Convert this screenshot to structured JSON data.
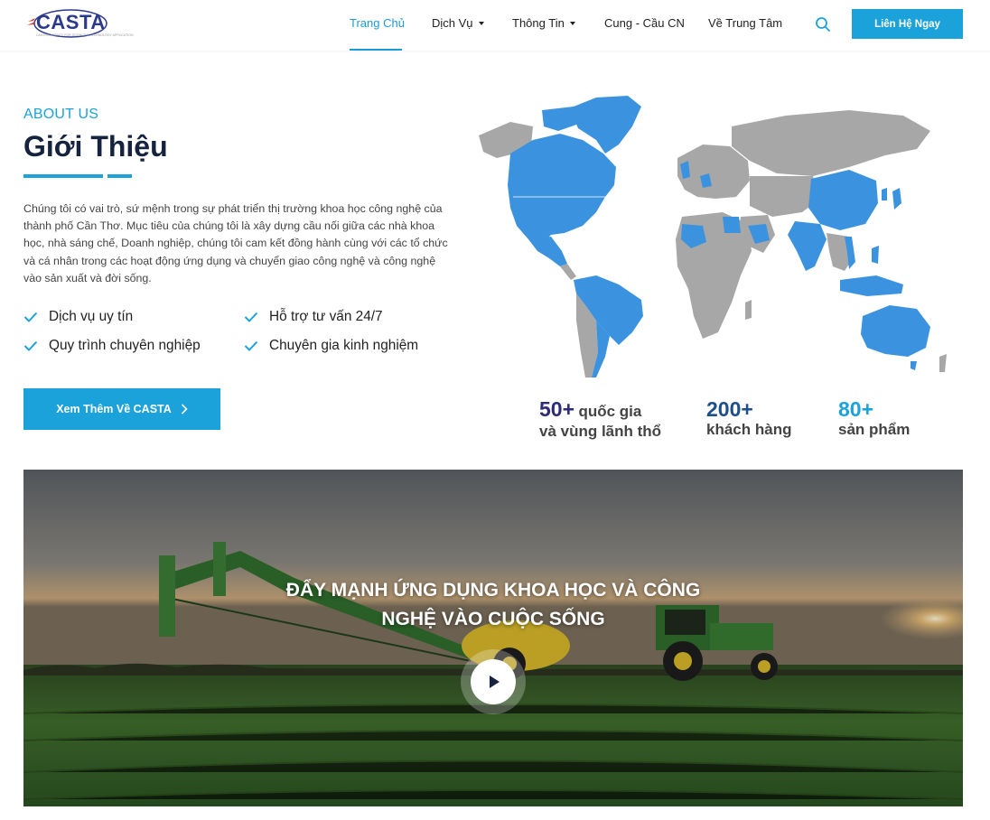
{
  "header": {
    "logo_text": "CASTA",
    "logo_tagline": "CANTHO AGENCY FOR SCIENCE & TECHNOLOGY APPLICATION",
    "nav": [
      {
        "label": "Trang Chủ",
        "active": true,
        "dropdown": false
      },
      {
        "label": "Dịch Vụ",
        "active": false,
        "dropdown": true
      },
      {
        "label": "Thông Tin",
        "active": false,
        "dropdown": true
      },
      {
        "label": "Cung - Cầu CN",
        "active": false,
        "dropdown": false
      },
      {
        "label": "Về Trung Tâm",
        "active": false,
        "dropdown": false
      }
    ],
    "search_icon": "search-icon",
    "contact_button": "Liên Hệ Ngay"
  },
  "about": {
    "eyebrow": "ABOUT US",
    "title": "Giới Thiệu",
    "description": "Chúng tôi có vai trò, sứ mệnh trong sự phát triển thị trường khoa học công nghệ của thành phố Cần Thơ. Mục tiêu của chúng tôi là xây dựng cầu nối giữa các nhà khoa học, nhà sáng chế, Doanh nghiệp, chúng tôi cam kết đồng hành cùng với các tổ chức và cá nhân trong các hoạt động ứng dụng và chuyển giao công nghệ và công nghệ vào sản xuất và đời sống.",
    "features": [
      "Dịch vụ uy tín",
      "Hỗ trợ tư vấn 24/7",
      "Quy trình chuyên nghiệp",
      "Chuyên gia kinh nghiệm"
    ],
    "more_button": "Xem Thêm Về CASTA"
  },
  "stats": [
    {
      "number": "50+",
      "label_inline": "quốc gia",
      "label": "và vùng lãnh thổ",
      "color": "#2d2a7a"
    },
    {
      "number": "200+",
      "label_inline": "",
      "label": "khách hàng",
      "color": "#1d4f8a"
    },
    {
      "number": "80+",
      "label_inline": "",
      "label": "sản phẩm",
      "color": "#1ba2db"
    }
  ],
  "banner": {
    "title_line1": "ĐẨY MẠNH ỨNG DỤNG KHOA HỌC VÀ CÔNG",
    "title_line2": "NGHỆ VÀO CUỘC SỐNG",
    "play_icon": "play-icon"
  },
  "colors": {
    "accent": "#1ba2db",
    "heading": "#16233f",
    "map_highlight": "#3b93e0",
    "map_base": "#a7a7a7"
  }
}
